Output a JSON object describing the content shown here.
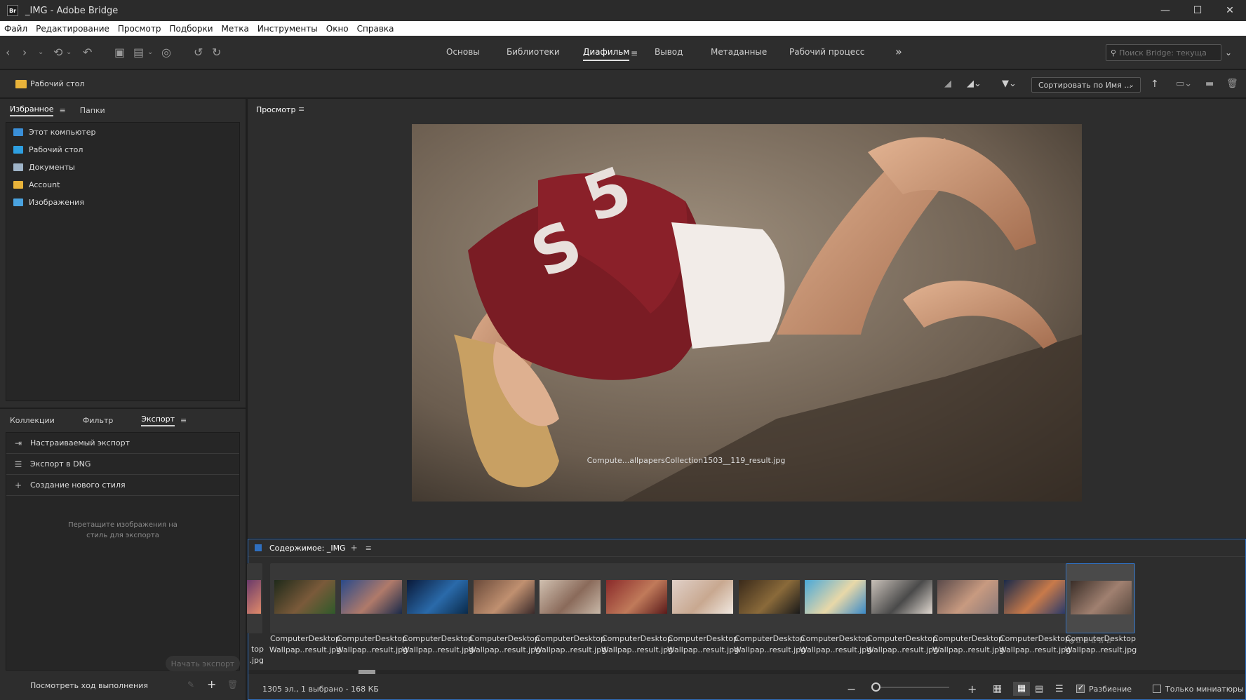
{
  "window": {
    "app_badge": "Br",
    "title": "_IMG - Adobe Bridge",
    "minimize": "—",
    "maximize": "☐",
    "close": "✕"
  },
  "menu": [
    "Файл",
    "Редактирование",
    "Просмотр",
    "Подборки",
    "Метка",
    "Инструменты",
    "Окно",
    "Справка"
  ],
  "workspaces": {
    "tabs": [
      "Основы",
      "Библиотеки",
      "Диафильм",
      "Вывод",
      "Метаданные",
      "Рабочий процесс"
    ],
    "active": "Диафильм",
    "more": "»"
  },
  "search": {
    "placeholder": "Поиск Bridge: текуща"
  },
  "path": {
    "current": "Рабочий стол"
  },
  "sort": {
    "label": "Сортировать по Имя ..."
  },
  "favorites_panel": {
    "tabs": [
      "Избранное",
      "Папки"
    ],
    "items": [
      {
        "label": "Этот компьютер",
        "color": "#3a8fd8"
      },
      {
        "label": "Рабочий стол",
        "color": "#2e9fe0"
      },
      {
        "label": "Документы",
        "color": "#9fb4c8"
      },
      {
        "label": "Account",
        "color": "#e8b33a"
      },
      {
        "label": "Изображения",
        "color": "#4aa3e0"
      }
    ]
  },
  "export_panel": {
    "tabs": [
      "Коллекции",
      "Фильтр",
      "Экспорт"
    ],
    "items": [
      "Настраиваемый экспорт",
      "Экспорт в DNG",
      "Создание нового стиля"
    ],
    "hint_line1": "Перетащите изображения на",
    "hint_line2": "стиль для экспорта",
    "start_button": "Начать экспорт",
    "progress_link": "Посмотреть ход выполнения"
  },
  "preview": {
    "title": "Просмотр",
    "caption": "Compute...allpapersCollection1503__119_result.jpg"
  },
  "content": {
    "title": "Содержимое: _IMG",
    "partial_label_line1": "top",
    "partial_label_line2": ".jpg",
    "thumbnails": [
      {
        "line1": "ComputerDesktop",
        "line2": "Wallpap..result.jpg",
        "colors": [
          "#1f2a1a",
          "#7a5a3a",
          "#2f5a2a"
        ]
      },
      {
        "line1": "ComputerDesktop",
        "line2": "Wallpap..result.jpg",
        "colors": [
          "#2a4a8a",
          "#b07a6a",
          "#1a2a4a"
        ]
      },
      {
        "line1": "ComputerDesktop",
        "line2": "Wallpap..result.jpg",
        "colors": [
          "#0a1a3a",
          "#2a6aaa",
          "#0a2a4a"
        ]
      },
      {
        "line1": "ComputerDesktop",
        "line2": "Wallpap..result.jpg",
        "colors": [
          "#6a4a3a",
          "#c09070",
          "#3a2a2a"
        ]
      },
      {
        "line1": "ComputerDesktop",
        "line2": "Wallpap..result.jpg",
        "colors": [
          "#d0c0b0",
          "#8a6a5a",
          "#c8b8a8"
        ]
      },
      {
        "line1": "ComputerDesktop",
        "line2": "Wallpap..result.jpg",
        "colors": [
          "#8a2a2a",
          "#c07a5a",
          "#5a1a1a"
        ]
      },
      {
        "line1": "ComputerDesktop",
        "line2": "Wallpap..result.jpg",
        "colors": [
          "#e0d0c8",
          "#c8a890",
          "#f0e8e0"
        ]
      },
      {
        "line1": "ComputerDesktop",
        "line2": "Wallpap..result.jpg",
        "colors": [
          "#3a2a1a",
          "#8a6a3a",
          "#1a1a1a"
        ]
      },
      {
        "line1": "ComputerDesktop",
        "line2": "Wallpap..result.jpg",
        "colors": [
          "#4aa8d8",
          "#e8d8a8",
          "#3a8ac8"
        ]
      },
      {
        "line1": "ComputerDesktop",
        "line2": "Wallpap..result.jpg",
        "colors": [
          "#c8c0b8",
          "#4a4a4a",
          "#e0d8d0"
        ]
      },
      {
        "line1": "ComputerDesktop",
        "line2": "Wallpap..result.jpg",
        "colors": [
          "#5a4a4a",
          "#c89a80",
          "#8a7a7a"
        ]
      },
      {
        "line1": "ComputerDesktop",
        "line2": "Wallpap..result.jpg",
        "colors": [
          "#1a2a4a",
          "#c87a4a",
          "#2a3a6a"
        ]
      },
      {
        "line1": "ComputerDesktop",
        "line2": "Wallpap..result.jpg",
        "colors": [
          "#3a2e28",
          "#a08070",
          "#5a4a40"
        ],
        "selected": true
      }
    ],
    "rating": "⦸☆☆☆☆☆",
    "status": "1305 эл., 1 выбрано - 168 КБ",
    "zoom_minus": "−",
    "zoom_plus": "+",
    "zoom_level": 0,
    "split_label": "Разбиение",
    "split_checked": true,
    "thumbs_only_label": "Только миниатюры",
    "thumbs_only_checked": false
  },
  "colors": {
    "accent": "#2f6fbf",
    "panel_bg": "#2d2d2d",
    "app_bg": "#1e1e1e"
  }
}
